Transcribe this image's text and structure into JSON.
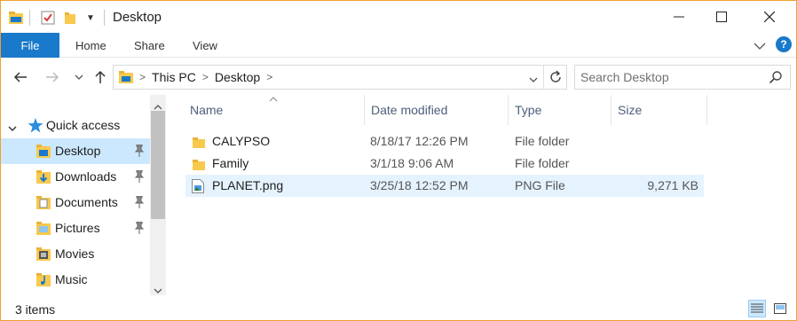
{
  "window": {
    "title": "Desktop"
  },
  "ribbon": {
    "file": "File",
    "tabs": [
      "Home",
      "Share",
      "View"
    ],
    "help": "?"
  },
  "address": {
    "crumbs": [
      "This PC",
      "Desktop"
    ]
  },
  "search": {
    "placeholder": "Search Desktop"
  },
  "sidebar": {
    "items": [
      {
        "label": "Quick access",
        "icon": "star-icon"
      },
      {
        "label": "Desktop",
        "icon": "desktop-folder-icon",
        "pinned": true
      },
      {
        "label": "Downloads",
        "icon": "downloads-folder-icon",
        "pinned": true
      },
      {
        "label": "Documents",
        "icon": "documents-folder-icon",
        "pinned": true
      },
      {
        "label": "Pictures",
        "icon": "pictures-folder-icon",
        "pinned": true
      },
      {
        "label": "Movies",
        "icon": "movies-folder-icon"
      },
      {
        "label": "Music",
        "icon": "music-folder-icon"
      }
    ]
  },
  "columns": [
    "Name",
    "Date modified",
    "Type",
    "Size"
  ],
  "files": [
    {
      "name": "CALYPSO",
      "date": "8/18/17 12:26 PM",
      "type": "File folder",
      "size": ""
    },
    {
      "name": "Family",
      "date": "3/1/18 9:06 AM",
      "type": "File folder",
      "size": ""
    },
    {
      "name": "PLANET.png",
      "date": "3/25/18 12:52 PM",
      "type": "PNG File",
      "size": "9,271 KB"
    }
  ],
  "status": {
    "count": "3 items"
  },
  "colors": {
    "accent": "#1979ca",
    "selection": "#cce8ff",
    "hover": "#e5f3ff",
    "border": "#f0a030"
  }
}
